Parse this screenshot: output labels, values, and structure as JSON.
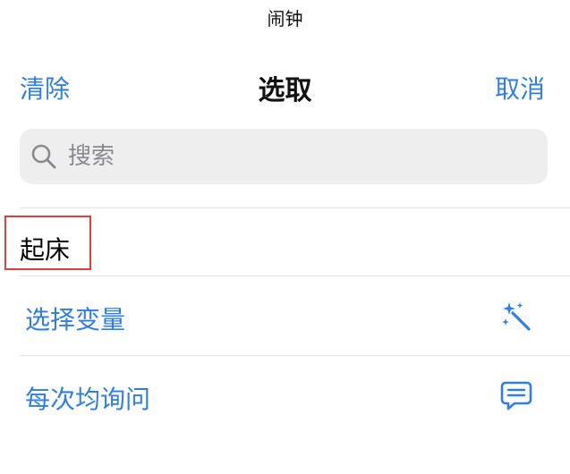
{
  "header": {
    "top_label": "闹钟"
  },
  "nav": {
    "clear_label": "清除",
    "title": "选取",
    "cancel_label": "取消"
  },
  "search": {
    "placeholder": "搜索",
    "value": ""
  },
  "list": {
    "selected_item": "起床",
    "options": [
      {
        "label": "选择变量",
        "icon": "magic-wand-icon"
      },
      {
        "label": "每次均询问",
        "icon": "speech-bubble-icon"
      }
    ]
  },
  "colors": {
    "accent": "#2f7ee6",
    "highlight_border": "#e2403f",
    "search_bg": "#eeeeef"
  }
}
